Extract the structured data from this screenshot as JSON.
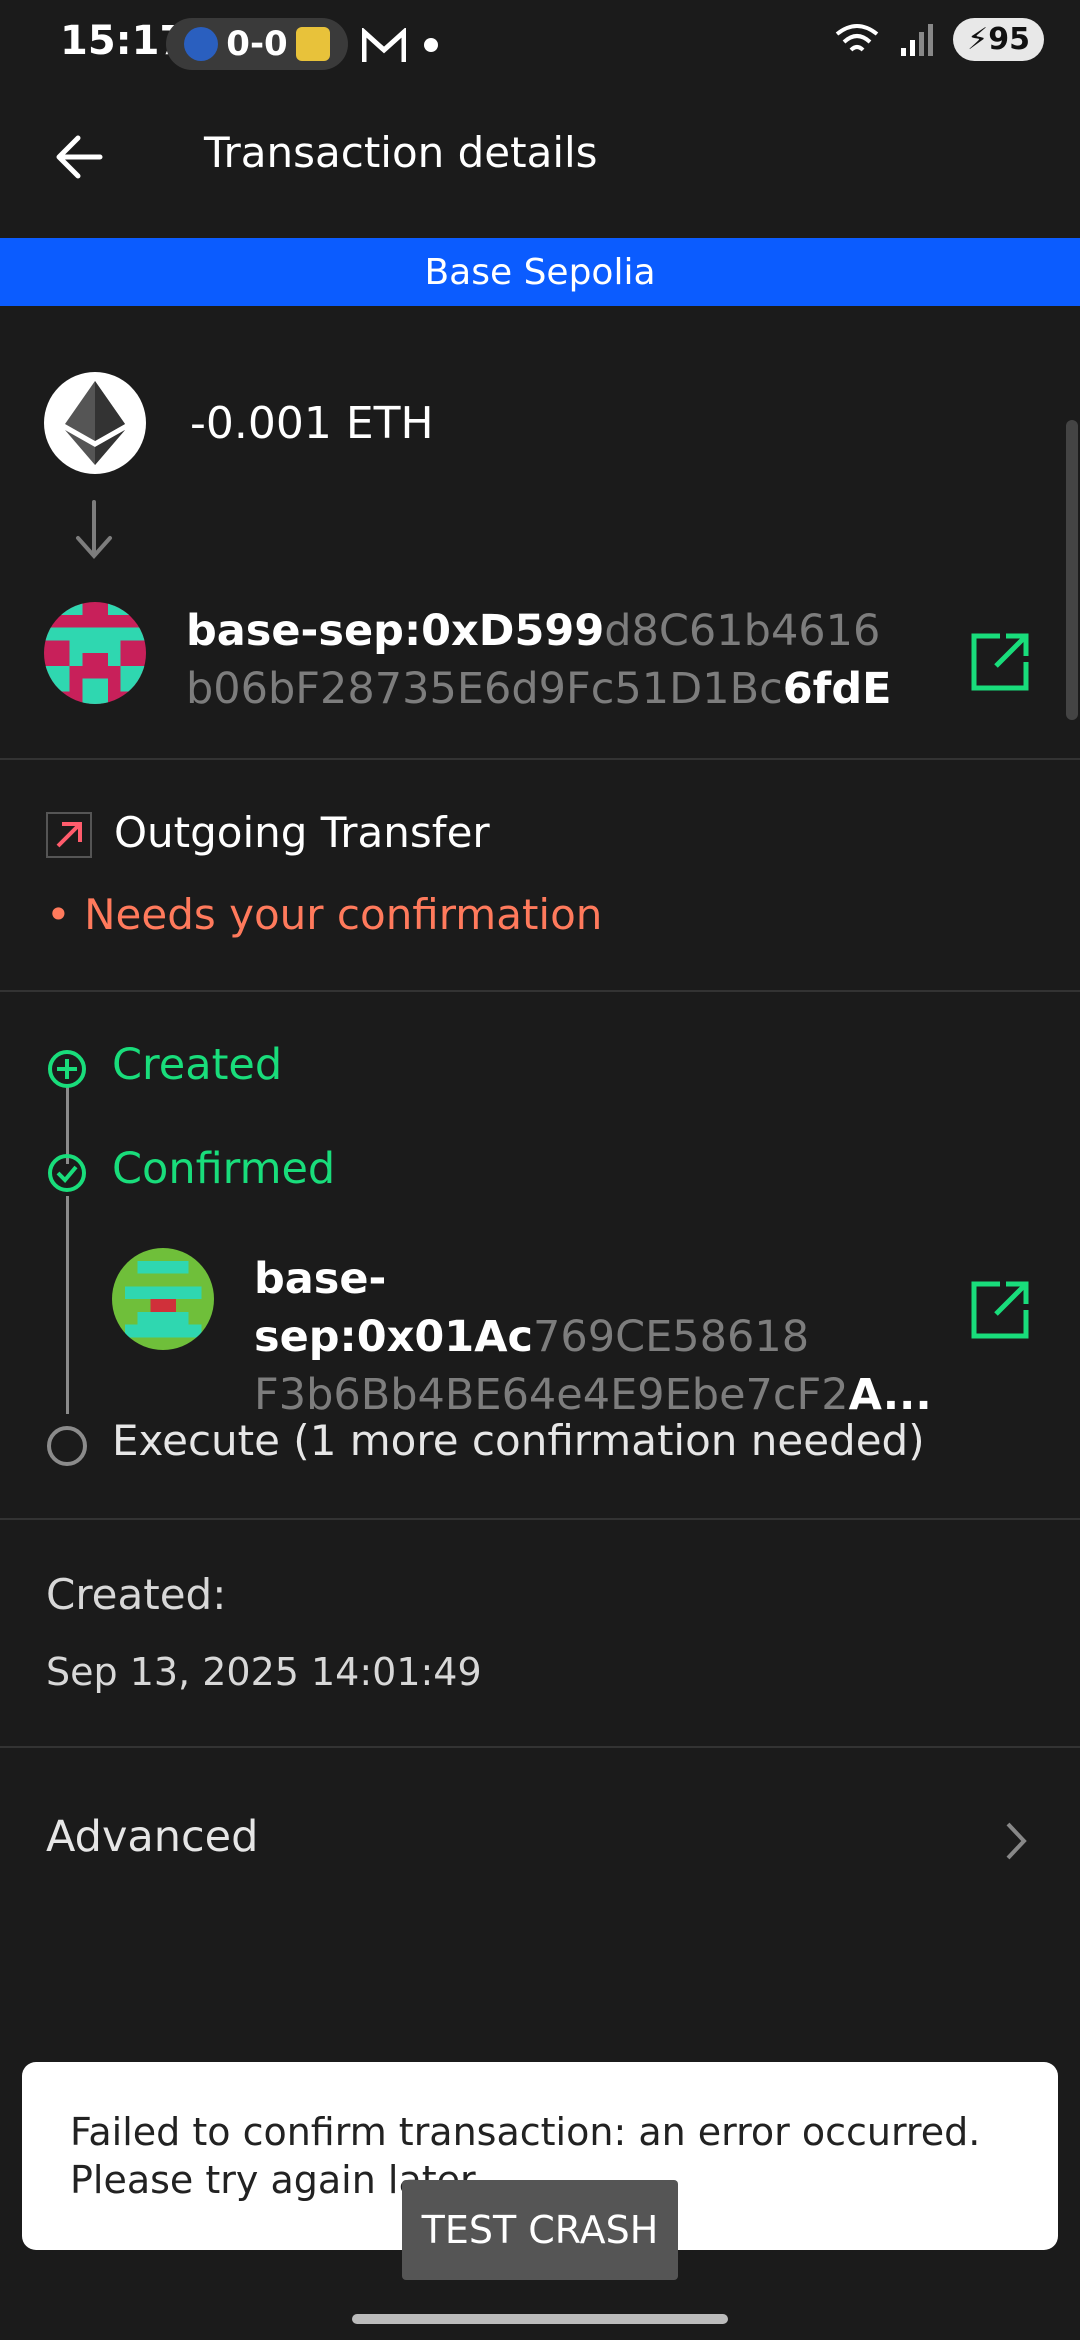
{
  "status_bar": {
    "time": "15:17",
    "score": "0-0",
    "battery": "95",
    "icons": [
      "gmail-icon",
      "dot-icon",
      "wifi-icon",
      "signal-icon",
      "battery-icon"
    ]
  },
  "header": {
    "title": "Transaction details"
  },
  "network": "Base Sepolia",
  "amount": "-0.001 ETH",
  "recipient": {
    "prefix": "base-sep:0xD599",
    "middle1": "d8C61b4616",
    "middle2": "b06bF28735E6d9Fc51D1Bc",
    "suffix": "6fdE"
  },
  "transfer": {
    "type": "Outgoing Transfer",
    "status": "• Needs your confirmation"
  },
  "timeline": {
    "created": "Created",
    "confirmed": "Confirmed",
    "signer": {
      "prefix": "base-sep:0x01Ac",
      "middle1": "769CE58618",
      "middle2": "F3b6Bb4BE64e4E9Ebe7cF2",
      "suffix": "A..."
    },
    "execute": "Execute (1 more confirmation needed)"
  },
  "created_info": {
    "label": "Created:",
    "value": "Sep 13, 2025 14:01:49"
  },
  "advanced": "Advanced",
  "toast": {
    "message": "Failed to confirm transaction: an error occurred. Please try again later."
  },
  "test_button": "TEST CRASH",
  "colors": {
    "accent_green": "#19dd7b",
    "network_blue": "#0b5cff",
    "warning_orange": "#ff7a5c"
  }
}
